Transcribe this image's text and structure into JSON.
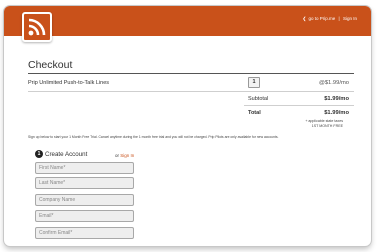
{
  "header": {
    "back_link": "go to Prip.me",
    "separator": "|",
    "signin_link": "Sign In",
    "accent_color": "#c9511a"
  },
  "logo": {
    "icon": "rss-feed-icon"
  },
  "checkout": {
    "title": "Checkout",
    "line_item": {
      "name": "Prip Unlimited Push-to-Talk Lines",
      "quantity": "1",
      "price": "@$1.99/mo"
    },
    "subtotal": {
      "label": "Subtotal",
      "value": "$1.99/mo"
    },
    "total": {
      "label": "Total",
      "value": "$1.99/mo"
    },
    "notes": [
      "+ applicable state taxes",
      "1ST MONTH FREE"
    ],
    "disclaimer": "Sign up below to start your 1 Month Free Trial. Cancel anytime during the 1 month free trial and you will not be charged. Prip Pilots are only available for new accounts."
  },
  "account": {
    "step_number": "1",
    "title": "Create Account",
    "or_text": "or",
    "signin_link": "Sign In",
    "fields": {
      "first_name": "First Name*",
      "last_name": "Last Name*",
      "company_name": "Company Name",
      "email": "Email*",
      "confirm_email": "Confirm Email*"
    }
  }
}
